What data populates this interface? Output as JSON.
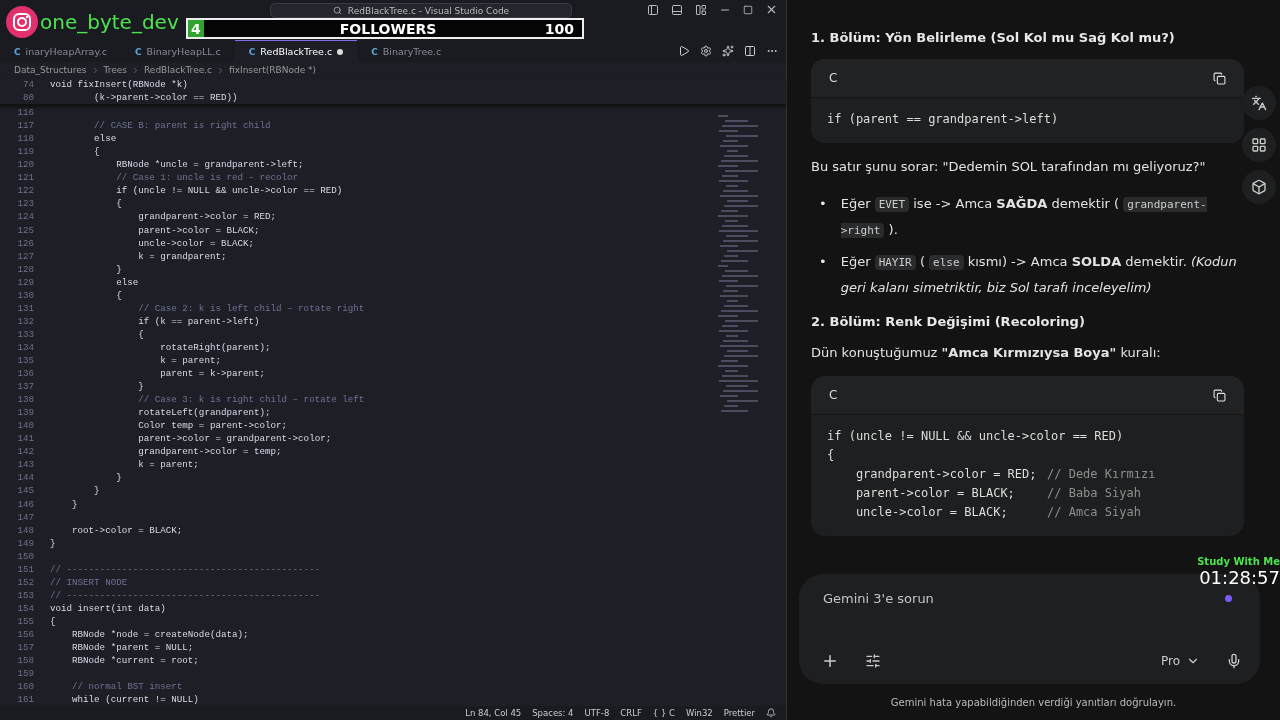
{
  "overlay": {
    "handle": "one_byte_dev",
    "followers": {
      "count": "4",
      "label": "FOLLOWERS",
      "goal": "100",
      "level": 0.04
    },
    "timer": {
      "label": "Study With Me",
      "time": "01:28:57"
    }
  },
  "editor": {
    "title": "RedBlackTree.c - Visual Studio Code",
    "tabs": [
      {
        "icon": "C",
        "label": "inaryHeapArray.c",
        "selected": false,
        "modified": false
      },
      {
        "icon": "C",
        "label": "BinaryHeapLL.c",
        "selected": false,
        "modified": false
      },
      {
        "icon": "C",
        "label": "RedBlackTree.c",
        "selected": true,
        "modified": true
      },
      {
        "icon": "C",
        "label": "BinaryTree.c",
        "selected": false,
        "modified": false
      }
    ],
    "breadcrumb": [
      "Data_Structures",
      "Trees",
      "RedBlackTree.c",
      "fixInsert(RBNode *)"
    ],
    "sticky": [
      {
        "num": "74",
        "text": "void fixInsert(RBNode *k)",
        "kind": "code"
      },
      {
        "num": "80",
        "text": "        (k->parent->color == RED))",
        "kind": "code"
      }
    ],
    "lines": [
      {
        "num": "116"
      },
      {
        "num": "117",
        "text": "        // CASE B: parent is right child",
        "kind": "comment"
      },
      {
        "num": "118",
        "text": "        else",
        "kind": "code"
      },
      {
        "num": "119",
        "text": "        {",
        "kind": "code"
      },
      {
        "num": "120",
        "text": "            RBNode *uncle = grandparent->left;",
        "kind": "code"
      },
      {
        "num": "121",
        "text": "            // Case 1: uncle is red – recolor",
        "kind": "comment"
      },
      {
        "num": "122",
        "text": "            if (uncle != NULL && uncle->color == RED)",
        "kind": "code"
      },
      {
        "num": "123",
        "text": "            {",
        "kind": "code"
      },
      {
        "num": "124",
        "text": "                grandparent->color = RED;",
        "kind": "code"
      },
      {
        "num": "125",
        "text": "                parent->color = BLACK;",
        "kind": "code"
      },
      {
        "num": "126",
        "text": "                uncle->color = BLACK;",
        "kind": "code"
      },
      {
        "num": "127",
        "text": "                k = grandparent;",
        "kind": "code"
      },
      {
        "num": "128",
        "text": "            }",
        "kind": "code"
      },
      {
        "num": "129",
        "text": "            else",
        "kind": "code"
      },
      {
        "num": "130",
        "text": "            {",
        "kind": "code"
      },
      {
        "num": "131",
        "text": "                // Case 2: k is left child – rotate right",
        "kind": "comment"
      },
      {
        "num": "132",
        "text": "                if (k == parent->left)",
        "kind": "code"
      },
      {
        "num": "133",
        "text": "                {",
        "kind": "code"
      },
      {
        "num": "134",
        "text": "                    rotateRight(parent);",
        "kind": "code"
      },
      {
        "num": "135",
        "text": "                    k = parent;",
        "kind": "code"
      },
      {
        "num": "136",
        "text": "                    parent = k->parent;",
        "kind": "code"
      },
      {
        "num": "137",
        "text": "                }",
        "kind": "code"
      },
      {
        "num": "138",
        "text": "                // Case 3: k is right child – rotate left",
        "kind": "comment"
      },
      {
        "num": "139",
        "text": "                rotateLeft(grandparent);",
        "kind": "code"
      },
      {
        "num": "140",
        "text": "                Color temp = parent->color;",
        "kind": "code"
      },
      {
        "num": "141",
        "text": "                parent->color = grandparent->color;",
        "kind": "code"
      },
      {
        "num": "142",
        "text": "                grandparent->color = temp;",
        "kind": "code"
      },
      {
        "num": "143",
        "text": "                k = parent;",
        "kind": "code"
      },
      {
        "num": "144",
        "text": "            }",
        "kind": "code"
      },
      {
        "num": "145",
        "text": "        }",
        "kind": "code"
      },
      {
        "num": "146",
        "text": "    }",
        "kind": "code"
      },
      {
        "num": "147"
      },
      {
        "num": "148",
        "text": "    root->color = BLACK;",
        "kind": "code"
      },
      {
        "num": "149",
        "text": "}",
        "kind": "code"
      },
      {
        "num": "150"
      },
      {
        "num": "151",
        "text": "// ----------------------------------------------",
        "kind": "comment"
      },
      {
        "num": "152",
        "text": "// INSERT NODE",
        "kind": "comment"
      },
      {
        "num": "153",
        "text": "// ----------------------------------------------",
        "kind": "comment"
      },
      {
        "num": "154",
        "text": "void insert(int data)",
        "kind": "code"
      },
      {
        "num": "155",
        "text": "{",
        "kind": "code"
      },
      {
        "num": "156",
        "text": "    RBNode *node = createNode(data);",
        "kind": "code"
      },
      {
        "num": "157",
        "text": "    RBNode *parent = NULL;",
        "kind": "code"
      },
      {
        "num": "158",
        "text": "    RBNode *current = root;",
        "kind": "code"
      },
      {
        "num": "159"
      },
      {
        "num": "160",
        "text": "    // normal BST insert",
        "kind": "comment"
      },
      {
        "num": "161",
        "text": "    while (current != NULL)",
        "kind": "code"
      }
    ],
    "status": [
      "Ln 84, Col 45",
      "Spaces: 4",
      "UTF-8",
      "CRLF",
      "{ } C",
      "Win32",
      "Prettier"
    ]
  },
  "chat": {
    "blocks": [
      {
        "kind": "heading",
        "text": "1. Bölüm: Yön Belirleme (Sol Kol mu Sağ Kol mu?)"
      },
      {
        "kind": "codeblock",
        "lang": "C",
        "lines": [
          {
            "code": "if (parent == grandparent->left)"
          }
        ]
      },
      {
        "kind": "paragraph",
        "text": "Bu satır şunu sorar: \"Dedemin SOL tarafından mı geliyoruz?\""
      },
      {
        "kind": "bullets",
        "items": [
          {
            "marker": "•",
            "parts": [
              {
                "kind": "text",
                "text": "Eğer "
              },
              {
                "kind": "code",
                "text": "EVET"
              },
              {
                "kind": "text",
                "text": " ise -> Amca **SAĞDA** demektir ( "
              },
              {
                "kind": "code",
                "text": "grandparent->right"
              },
              {
                "kind": "text",
                "text": " )."
              }
            ]
          },
          {
            "marker": "•",
            "parts": [
              {
                "kind": "text",
                "text": "Eğer "
              },
              {
                "kind": "code",
                "text": "HAYIR"
              },
              {
                "kind": "text",
                "text": " ( "
              },
              {
                "kind": "code",
                "text": "else"
              },
              {
                "kind": "text",
                "text": " kısmı) -> Amca **SOLDA** demektir. *(Kodun geri kalanı simetriktir, biz Sol tarafı inceleyelim)*"
              }
            ]
          }
        ]
      },
      {
        "kind": "heading",
        "text": "2. Bölüm: Renk Değişimi (Recoloring)"
      },
      {
        "kind": "paragraph",
        "text": "Dün konuştuğumuz **\"Amca Kırmızıysa Boya\"** kuralı:"
      },
      {
        "kind": "codeblock",
        "lang": "C",
        "lines": [
          {
            "code": "if (uncle != NULL && uncle->color == RED)"
          },
          {
            "code": "{"
          },
          {
            "code": "    grandparent->color = RED;",
            "comment": "// Dede Kırmızı"
          },
          {
            "code": "    parent->color = BLACK;",
            "comment": "// Baba Siyah"
          },
          {
            "code": "    uncle->color = BLACK;",
            "comment": "// Amca Siyah"
          }
        ]
      }
    ],
    "input": {
      "placeholder": "Gemini 3'e sorun",
      "model": "Pro"
    },
    "disclaimer": "Gemini hata yapabildiğinden verdiği yanıtları doğrulayın."
  }
}
